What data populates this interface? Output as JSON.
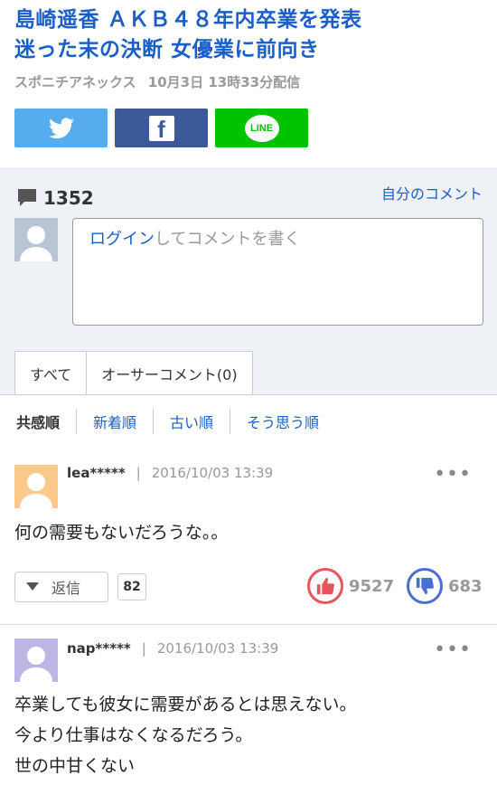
{
  "article": {
    "headline_line1": "島崎遥香 ＡＫＢ４８年内卒業を発表",
    "headline_line2": "迷った末の決断 女優業に前向き",
    "source": "スポニチアネックス",
    "published": "10月3日 13時33分配信"
  },
  "share": {
    "twitter_icon": "twitter-bird-icon",
    "facebook_label": "f",
    "line_label": "LINE",
    "colors": {
      "twitter": "#55acee",
      "facebook": "#3b5998",
      "line": "#00c300"
    }
  },
  "comments_section": {
    "count": "1352",
    "my_comments_link": "自分のコメント",
    "input": {
      "login_link": "ログイン",
      "prompt": "してコメントを書く"
    },
    "tabs": [
      {
        "label": "すべて"
      },
      {
        "label": "オーサーコメント(0)"
      }
    ],
    "sort": {
      "options": [
        "共感順",
        "新着順",
        "古い順",
        "そう思う順"
      ],
      "active": "共感順"
    }
  },
  "comments": [
    {
      "user": "lea*****",
      "separator": "|",
      "date": "2016/10/03 13:39",
      "body": [
        "何の需要もないだろうな。。"
      ],
      "reply_label": "返信",
      "reply_count": "82",
      "likes": "9527",
      "dislikes": "683",
      "avatar_color": "#fbc98a"
    },
    {
      "user": "nap*****",
      "separator": "|",
      "date": "2016/10/03 13:39",
      "body": [
        "卒業しても彼女に需要があるとは思えない。",
        "今より仕事はなくなるだろう。",
        "世の中甘くない"
      ],
      "avatar_color": "#bdb5e3"
    }
  ],
  "more_icon": "ellipsis-icon"
}
